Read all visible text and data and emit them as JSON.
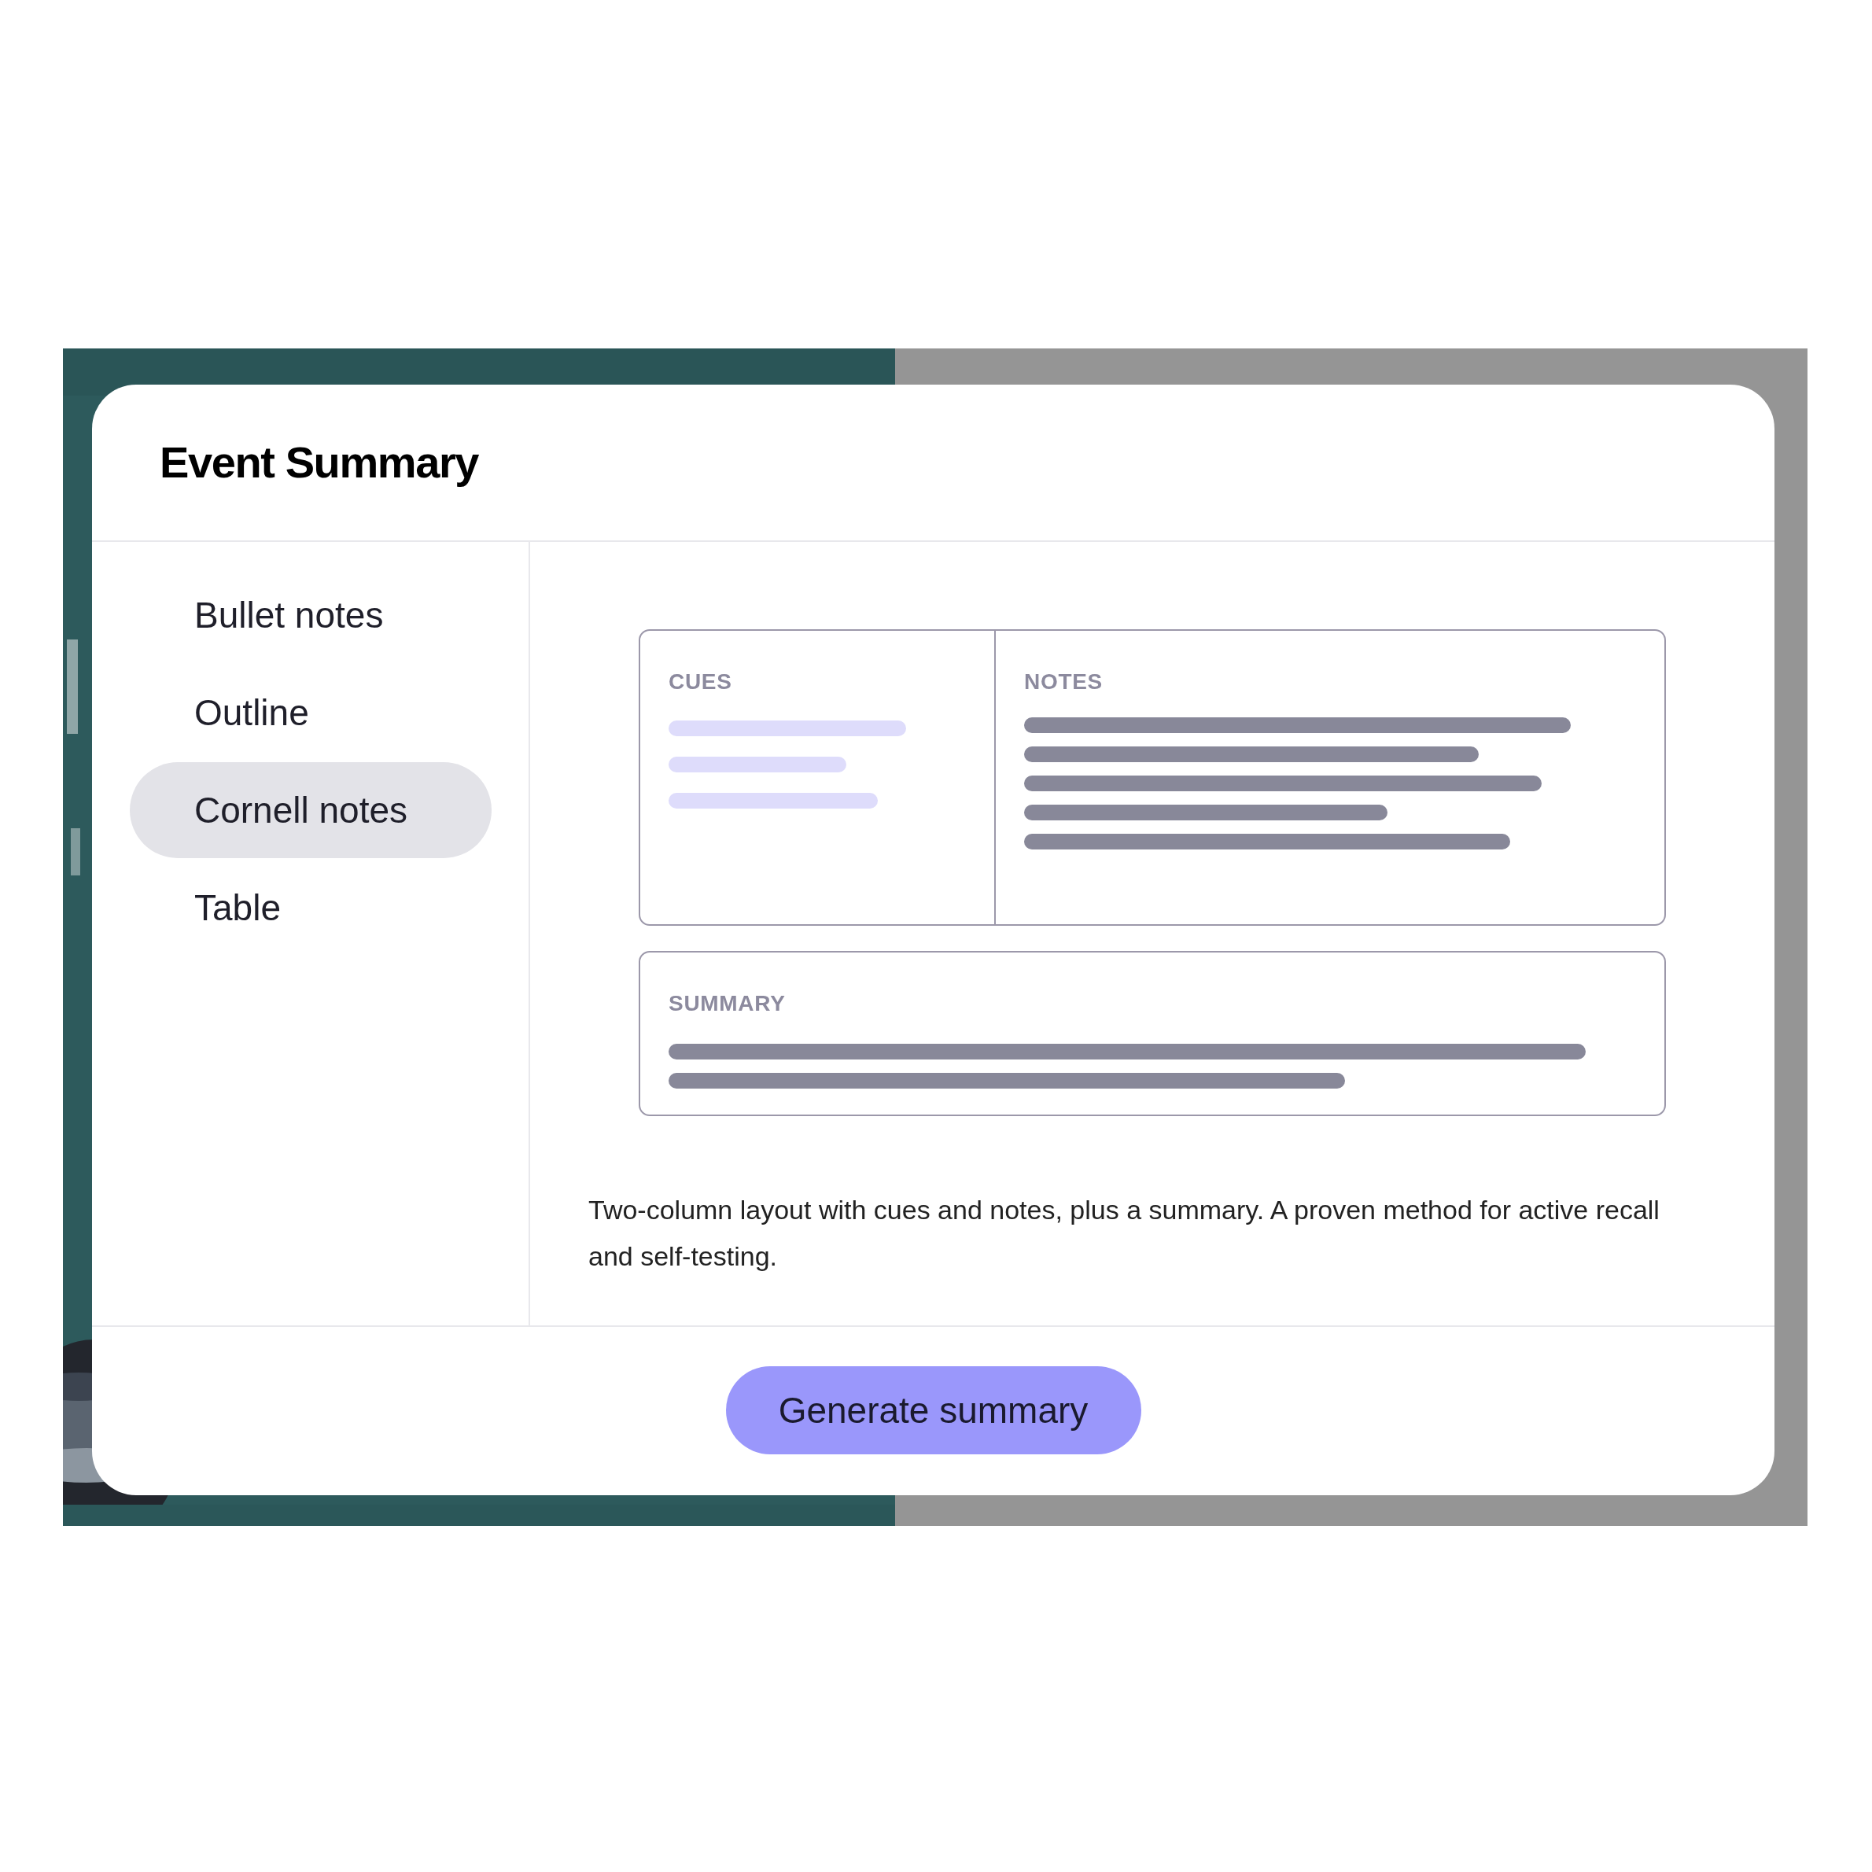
{
  "dialog": {
    "title": "Event Summary"
  },
  "formats": [
    {
      "label": "Bullet notes",
      "selected": false
    },
    {
      "label": "Outline",
      "selected": false
    },
    {
      "label": "Cornell notes",
      "selected": true
    },
    {
      "label": "Table",
      "selected": false
    }
  ],
  "preview": {
    "cues_label": "CUES",
    "notes_label": "NOTES",
    "summary_label": "SUMMARY"
  },
  "description": "Two-column layout with cues and notes, plus a summary. A proven method for active recall and self-testing.",
  "button": "Generate summary"
}
